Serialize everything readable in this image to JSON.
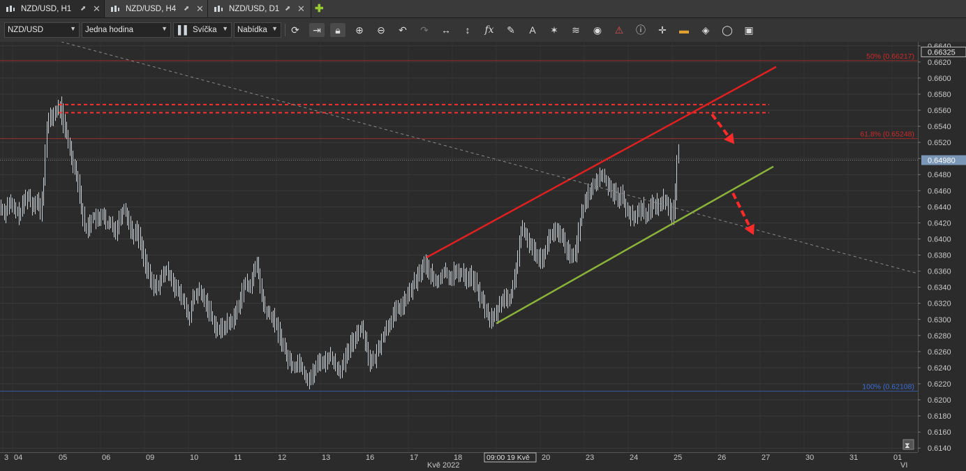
{
  "tabs": [
    {
      "label": "NZD/USD, H1",
      "active": true
    },
    {
      "label": "NZD/USD, H4",
      "active": false
    },
    {
      "label": "NZD/USD, D1",
      "active": false
    }
  ],
  "toolbar": {
    "symbol": "NZD/USD",
    "timeframe": "Jedna hodina",
    "chart_style": "Svíčka",
    "menu": "Nabídka",
    "icons": [
      "refresh-icon",
      "autoscroll-icon",
      "lock-icon",
      "zoom-in-icon",
      "zoom-out-icon",
      "undo-icon",
      "redo-icon",
      "fit-horizontal-icon",
      "fit-vertical-icon",
      "indicators-fx-icon",
      "draw-pencil-icon",
      "text-tool-icon",
      "crosshair-tool-icon",
      "layers-icon",
      "visibility-eye-icon",
      "alert-icon",
      "info-icon",
      "cursor-icon",
      "template-icon",
      "fill-bucket-icon",
      "settings-ring-icon",
      "save-icon"
    ]
  },
  "chart_data": {
    "type": "bar",
    "title": "",
    "xlabel": "",
    "ylabel": "",
    "ylim": [
      0.6135,
      0.6645
    ],
    "y_ticks": [
      0.614,
      0.616,
      0.618,
      0.62,
      0.622,
      0.624,
      0.626,
      0.628,
      0.63,
      0.632,
      0.634,
      0.636,
      0.638,
      0.64,
      0.642,
      0.644,
      0.646,
      0.648,
      0.65,
      0.652,
      0.654,
      0.656,
      0.658,
      0.66,
      0.662,
      0.664
    ],
    "x_ticks": [
      "3",
      "04",
      "05",
      "06",
      "09",
      "10",
      "11",
      "12",
      "13",
      "16",
      "17",
      "18",
      "19",
      "20",
      "23",
      "24",
      "25",
      "26",
      "27",
      "30",
      "31",
      "01"
    ],
    "x_month_labels": [
      "Kvě 2022",
      "VI"
    ],
    "cursor_label": "09:00 19 Kvě",
    "current_price": "0.64980",
    "top_price_label": "0.66325",
    "current_price_value": 0.6498,
    "price_path": [
      [
        0,
        0.644
      ],
      [
        6,
        0.6432
      ],
      [
        12,
        0.6446
      ],
      [
        20,
        0.6436
      ],
      [
        28,
        0.643
      ],
      [
        34,
        0.6448
      ],
      [
        40,
        0.6455
      ],
      [
        46,
        0.644
      ],
      [
        52,
        0.6452
      ],
      [
        58,
        0.643
      ],
      [
        63,
        0.648
      ],
      [
        66,
        0.654
      ],
      [
        70,
        0.6548
      ],
      [
        76,
        0.6555
      ],
      [
        82,
        0.656
      ],
      [
        86,
        0.6565
      ],
      [
        90,
        0.6545
      ],
      [
        96,
        0.6525
      ],
      [
        100,
        0.651
      ],
      [
        106,
        0.649
      ],
      [
        112,
        0.647
      ],
      [
        116,
        0.644
      ],
      [
        122,
        0.641
      ],
      [
        128,
        0.642
      ],
      [
        134,
        0.643
      ],
      [
        140,
        0.642
      ],
      [
        146,
        0.6435
      ],
      [
        152,
        0.6415
      ],
      [
        158,
        0.642
      ],
      [
        166,
        0.641
      ],
      [
        172,
        0.643
      ],
      [
        178,
        0.644
      ],
      [
        184,
        0.642
      ],
      [
        190,
        0.6405
      ],
      [
        196,
        0.641
      ],
      [
        202,
        0.639
      ],
      [
        208,
        0.637
      ],
      [
        214,
        0.635
      ],
      [
        220,
        0.634
      ],
      [
        228,
        0.6345
      ],
      [
        236,
        0.636
      ],
      [
        244,
        0.6355
      ],
      [
        250,
        0.634
      ],
      [
        258,
        0.633
      ],
      [
        264,
        0.632
      ],
      [
        270,
        0.63
      ],
      [
        276,
        0.6325
      ],
      [
        284,
        0.6335
      ],
      [
        292,
        0.6325
      ],
      [
        300,
        0.631
      ],
      [
        306,
        0.6295
      ],
      [
        312,
        0.6285
      ],
      [
        318,
        0.629
      ],
      [
        326,
        0.6295
      ],
      [
        334,
        0.63
      ],
      [
        342,
        0.632
      ],
      [
        350,
        0.6345
      ],
      [
        356,
        0.634
      ],
      [
        362,
        0.6355
      ],
      [
        368,
        0.637
      ],
      [
        374,
        0.633
      ],
      [
        380,
        0.631
      ],
      [
        386,
        0.6305
      ],
      [
        392,
        0.63
      ],
      [
        398,
        0.6285
      ],
      [
        404,
        0.627
      ],
      [
        410,
        0.6255
      ],
      [
        416,
        0.6245
      ],
      [
        422,
        0.624
      ],
      [
        428,
        0.625
      ],
      [
        434,
        0.6235
      ],
      [
        440,
        0.6225
      ],
      [
        446,
        0.623
      ],
      [
        452,
        0.624
      ],
      [
        458,
        0.625
      ],
      [
        464,
        0.6245
      ],
      [
        470,
        0.6255
      ],
      [
        476,
        0.625
      ],
      [
        482,
        0.624
      ],
      [
        488,
        0.6238
      ],
      [
        494,
        0.625
      ],
      [
        500,
        0.6265
      ],
      [
        506,
        0.6275
      ],
      [
        512,
        0.6285
      ],
      [
        518,
        0.629
      ],
      [
        524,
        0.627
      ],
      [
        530,
        0.6245
      ],
      [
        536,
        0.625
      ],
      [
        542,
        0.6265
      ],
      [
        548,
        0.628
      ],
      [
        554,
        0.629
      ],
      [
        560,
        0.63
      ],
      [
        566,
        0.631
      ],
      [
        572,
        0.6315
      ],
      [
        578,
        0.632
      ],
      [
        584,
        0.633
      ],
      [
        590,
        0.634
      ],
      [
        596,
        0.635
      ],
      [
        602,
        0.636
      ],
      [
        608,
        0.637
      ],
      [
        614,
        0.636
      ],
      [
        620,
        0.635
      ],
      [
        626,
        0.6345
      ],
      [
        632,
        0.6355
      ],
      [
        638,
        0.636
      ],
      [
        644,
        0.635
      ],
      [
        650,
        0.636
      ],
      [
        656,
        0.6355
      ],
      [
        662,
        0.636
      ],
      [
        668,
        0.635
      ],
      [
        674,
        0.6355
      ],
      [
        680,
        0.6345
      ],
      [
        686,
        0.633
      ],
      [
        692,
        0.632
      ],
      [
        698,
        0.6305
      ],
      [
        704,
        0.63
      ],
      [
        710,
        0.6305
      ],
      [
        716,
        0.632
      ],
      [
        722,
        0.633
      ],
      [
        728,
        0.632
      ],
      [
        734,
        0.634
      ],
      [
        740,
        0.637
      ],
      [
        746,
        0.641
      ],
      [
        752,
        0.6405
      ],
      [
        758,
        0.6395
      ],
      [
        764,
        0.6385
      ],
      [
        770,
        0.638
      ],
      [
        776,
        0.6375
      ],
      [
        782,
        0.639
      ],
      [
        788,
        0.6405
      ],
      [
        794,
        0.641
      ],
      [
        800,
        0.6405
      ],
      [
        806,
        0.64
      ],
      [
        812,
        0.6385
      ],
      [
        818,
        0.6375
      ],
      [
        824,
        0.6385
      ],
      [
        830,
        0.642
      ],
      [
        836,
        0.644
      ],
      [
        842,
        0.6455
      ],
      [
        848,
        0.6465
      ],
      [
        854,
        0.647
      ],
      [
        860,
        0.648
      ],
      [
        866,
        0.6475
      ],
      [
        872,
        0.6465
      ],
      [
        878,
        0.646
      ],
      [
        884,
        0.645
      ],
      [
        890,
        0.6455
      ],
      [
        896,
        0.644
      ],
      [
        902,
        0.643
      ],
      [
        908,
        0.6425
      ],
      [
        914,
        0.6435
      ],
      [
        920,
        0.644
      ],
      [
        926,
        0.6425
      ],
      [
        932,
        0.644
      ],
      [
        938,
        0.6445
      ],
      [
        944,
        0.644
      ],
      [
        950,
        0.645
      ],
      [
        956,
        0.6445
      ],
      [
        962,
        0.643
      ],
      [
        966,
        0.644
      ],
      [
        968,
        0.648
      ],
      [
        970,
        0.651
      ],
      [
        973,
        0.6498
      ]
    ],
    "horizontal_levels": [
      {
        "label": "50% (0.66217)",
        "value": 0.66217,
        "color": "#cc2b2b"
      },
      {
        "label": "61.8% (0.65248)",
        "value": 0.65248,
        "color": "#cc2b2b"
      },
      {
        "label": "100% (0.62108)",
        "value": 0.62108,
        "color": "#3a6fd8"
      }
    ],
    "resistance_zone": {
      "values": [
        0.6567,
        0.6557
      ],
      "color": "#ff3030"
    },
    "trendlines": [
      {
        "name": "upper-channel",
        "color": "#e02020",
        "from": [
          611,
          0.6377
        ],
        "to": [
          1112,
          0.6614
        ]
      },
      {
        "name": "lower-channel",
        "color": "#8bb33a",
        "from": [
          711,
          0.6295
        ],
        "to": [
          1108,
          0.649
        ]
      },
      {
        "name": "downtrend",
        "color": "#8a8a8a",
        "from": [
          80,
          0.6647
        ],
        "to": [
          1315,
          0.6357
        ]
      }
    ],
    "arrows": [
      {
        "from": [
          1020,
          0.6555
        ],
        "to": [
          1052,
          0.6518
        ]
      },
      {
        "from": [
          1050,
          0.6457
        ],
        "to": [
          1080,
          0.6405
        ]
      }
    ],
    "colors": {
      "background": "#2b2b2b",
      "bars": "#c9d0d6",
      "grid": "#444444",
      "axis_text": "#c8c8c8",
      "price_label_bg": "#7a97b8"
    }
  }
}
